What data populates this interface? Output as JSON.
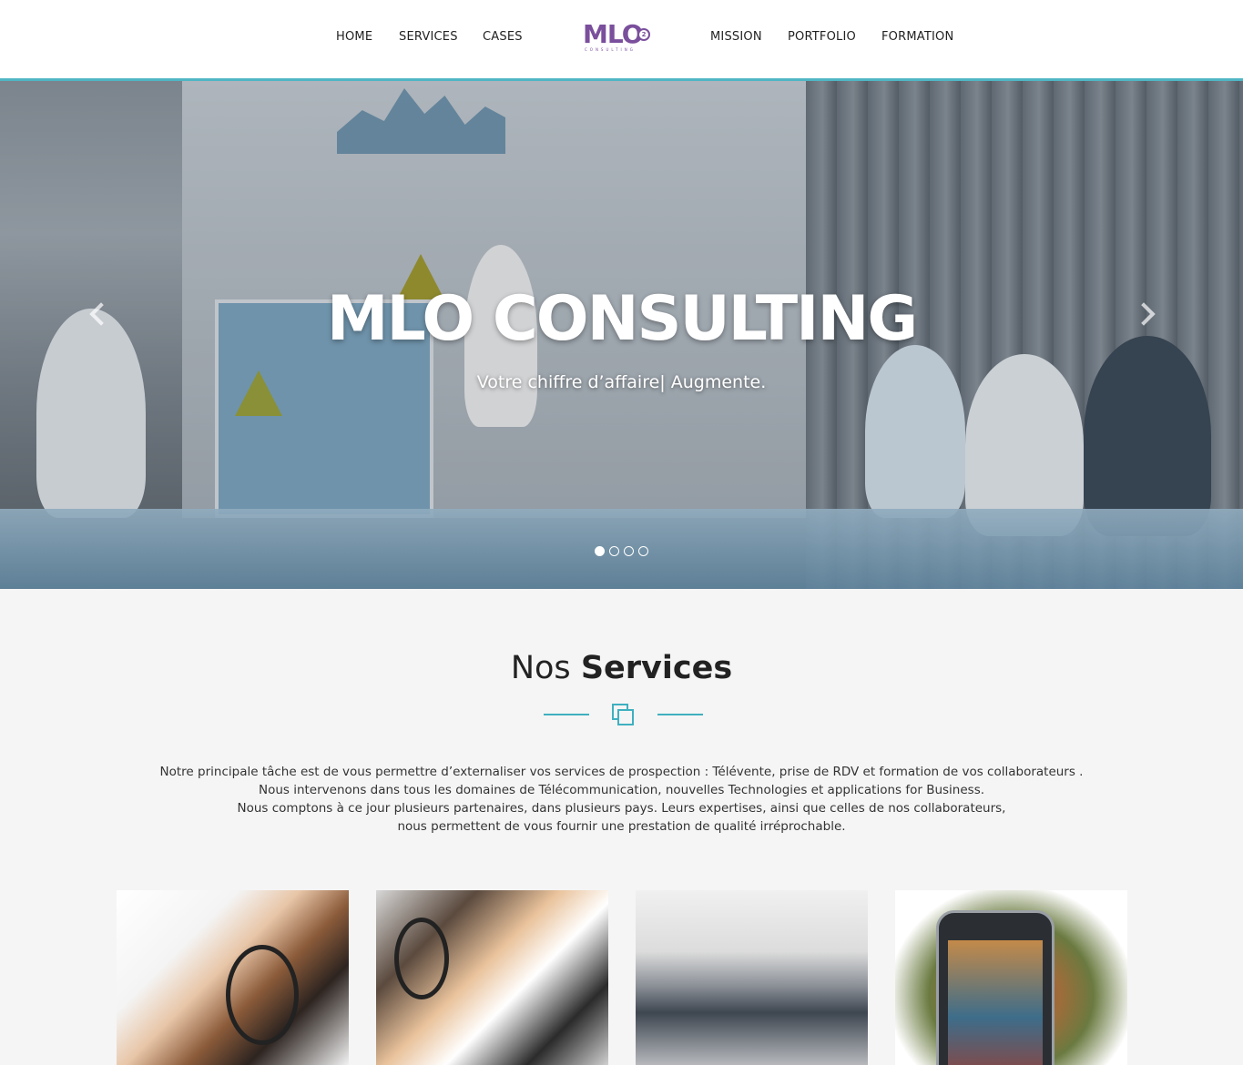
{
  "nav": {
    "left": [
      "HOME",
      "SERVICES",
      "CASES"
    ],
    "right": [
      "MISSION",
      "PORTFOLIO",
      "FORMATION"
    ],
    "logo": {
      "text": "MLO",
      "badge": "2",
      "subtitle": "CONSULTING"
    }
  },
  "hero": {
    "title": "MLO CONSULTING",
    "subtitle": "Votre chiffre d’affaire| Augmente.",
    "slides_count": 4,
    "active_slide": 1
  },
  "services": {
    "title_light": "Nos",
    "title_bold": "Services",
    "description": [
      "Notre principale tâche est de vous permettre d’externaliser vos services de prospection : Télévente, prise de RDV et formation de vos collaborateurs .",
      "Nous intervenons dans tous les domaines de Télécommunication, nouvelles Technologies et applications for Business.",
      "Nous comptons à ce jour plusieurs partenaires, dans plusieurs pays. Leurs expertises, ainsi que celles de nos collaborateurs,",
      "nous permettent de vous fournir une prestation de qualité irréprochable."
    ]
  },
  "colors": {
    "accent": "#4fb6c4",
    "brand": "#7a4f9c"
  }
}
